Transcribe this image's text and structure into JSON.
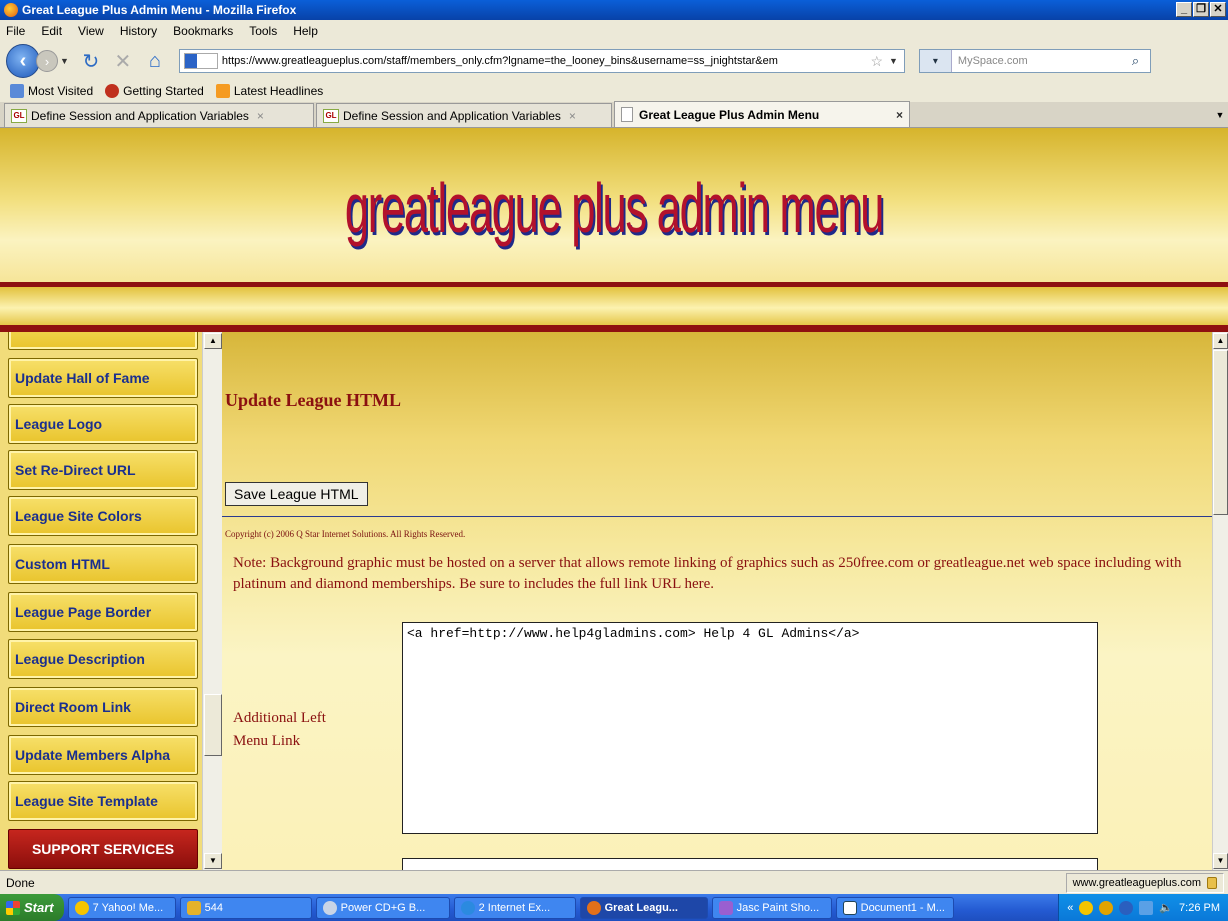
{
  "window": {
    "title": "Great League Plus Admin Menu - Mozilla Firefox"
  },
  "menubar": [
    "File",
    "Edit",
    "View",
    "History",
    "Bookmarks",
    "Tools",
    "Help"
  ],
  "navbar": {
    "url": "https://www.greatleagueplus.com/staff/members_only.cfm?lgname=the_looney_bins&username=ss_jnightstar&em",
    "search_placeholder": "MySpace.com"
  },
  "bookmarks": [
    "Most Visited",
    "Getting Started",
    "Latest Headlines"
  ],
  "tabs": [
    {
      "label": "Define Session and Application Variables",
      "active": false
    },
    {
      "label": "Define Session and Application Variables",
      "active": false
    },
    {
      "label": "Great League Plus Admin Menu",
      "active": true
    }
  ],
  "banner": {
    "title": "greatleague plus admin menu"
  },
  "sidebar": {
    "items": [
      "Update Hall of Fame",
      "League Logo",
      "Set Re-Direct URL",
      "League Site Colors",
      "Custom HTML",
      "League Page Border",
      "League Description",
      "Direct Room Link",
      "Update Members Alpha",
      "League Site Template"
    ],
    "support": "SUPPORT SERVICES"
  },
  "main": {
    "heading": "Update League HTML",
    "save_button": "Save League HTML",
    "copyright": "Copyright (c) 2006 Q Star Internet Solutions. All Rights Reserved.",
    "note": "Note: Background graphic must be hosted on a server that allows remote linking of graphics such as 250free.com or greatleague.net web space including with platinum and diamond memberships. Be sure to includes the full link URL here.",
    "field_label": "Additional Left Menu Link",
    "field_value": "<a href=http://www.help4gladmins.com> Help 4 GL Admins</a>"
  },
  "statusbar": {
    "status": "Done",
    "site": "www.greatleagueplus.com"
  },
  "taskbar": {
    "start": "Start",
    "tasks": [
      "7 Yahoo! Me...",
      "544",
      "Power CD+G B...",
      "2 Internet Ex...",
      "Great Leagu...",
      "Jasc Paint Sho...",
      "Document1 - M..."
    ],
    "clock": "7:26 PM"
  },
  "colors": {
    "accent_red": "#8a1010",
    "nav_blue": "#1a2f8f",
    "gold": "#e9c42c"
  }
}
